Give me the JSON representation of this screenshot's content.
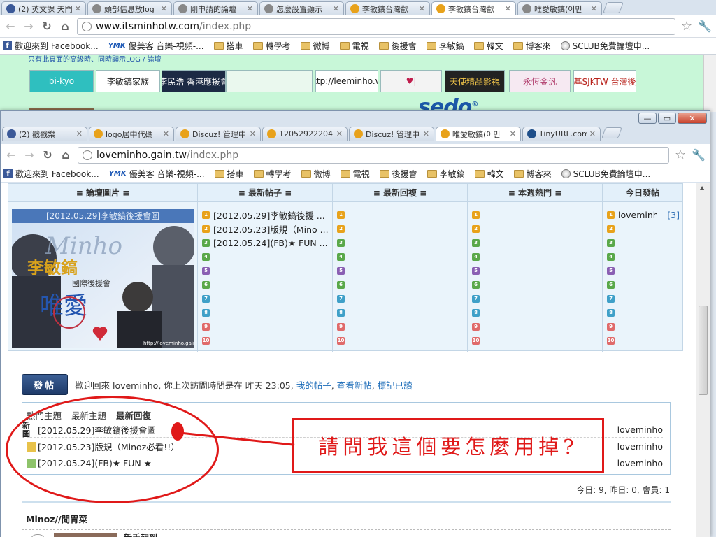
{
  "window1": {
    "tabs": [
      {
        "title": "(2) 英文課 天門",
        "color": "#3b5998"
      },
      {
        "title": "頭部信息放log",
        "color": "#888888"
      },
      {
        "title": "剛申請的論壇",
        "color": "#888888"
      },
      {
        "title": "怎麼設置顯示",
        "color": "#888888"
      },
      {
        "title": "李敏鎬台灣歡",
        "color": "#e8a21b"
      },
      {
        "title": "李敏鎬台灣歡",
        "color": "#e8a21b"
      },
      {
        "title": "唯愛敏鎬(이민",
        "color": "#888888"
      }
    ],
    "url_host": "www.itsminhotw.com",
    "url_path": "/index.php",
    "hidden_text": "只有此頁面的高級時、同時顯示LOG / 論壇",
    "banners": [
      {
        "text": "bi-kyo",
        "bg": "#2fbfbf",
        "fg": "#ffffff"
      },
      {
        "text": "李敏鎬家族",
        "bg": "#ffffff",
        "fg": "#222222"
      },
      {
        "text": "李民浩 香港應援會",
        "bg": "#1c2a44",
        "fg": "#ffffff"
      },
      {
        "text": "",
        "bg": "#eaf8ee",
        "fg": "#222222"
      },
      {
        "text": "http://leeminho.vn",
        "bg": "#ffffff",
        "fg": "#222222"
      },
      {
        "text": "♥|",
        "bg": "#f3f3f3",
        "fg": "#c01c4c"
      },
      {
        "text": "天使精品影視",
        "bg": "#222222",
        "fg": "#f3c64a"
      },
      {
        "text": "永恆金汎",
        "bg": "#f6e9f2",
        "fg": "#b03a6a"
      },
      {
        "text": "宋仲基SJKTW 台灣後援會",
        "bg": "#ffffff",
        "fg": "#b8221b"
      }
    ],
    "sedo": "sedo"
  },
  "window2": {
    "tabs": [
      {
        "title": "(2) 戳戳樂",
        "color": "#3b5998"
      },
      {
        "title": "logo居中代碼",
        "color": "#e8a21b"
      },
      {
        "title": "Discuz! 管理中",
        "color": "#e8a21b"
      },
      {
        "title": "12052922204",
        "color": "#e8a21b"
      },
      {
        "title": "Discuz! 管理中",
        "color": "#e8a21b"
      },
      {
        "title": "唯愛敏鎬(이민",
        "color": "#e8a21b"
      },
      {
        "title": "TinyURL.com",
        "color": "#1f4f8a"
      }
    ],
    "url_host": "loveminho.gain.tw",
    "url_path": "/index.php"
  },
  "bookmarks": [
    {
      "label": "歡迎來到 Facebook...",
      "icon": "facebook-icon"
    },
    {
      "label": "優美客 音樂-視頻-...",
      "icon": "ymk-icon"
    },
    {
      "label": "搭車",
      "icon": "folder-icon"
    },
    {
      "label": "轉學考",
      "icon": "folder-icon"
    },
    {
      "label": "微博",
      "icon": "folder-icon"
    },
    {
      "label": "電視",
      "icon": "folder-icon"
    },
    {
      "label": "後援會",
      "icon": "folder-icon"
    },
    {
      "label": "李敏鎬",
      "icon": "folder-icon"
    },
    {
      "label": "韓文",
      "icon": "folder-icon"
    },
    {
      "label": "博客來",
      "icon": "folder-icon"
    },
    {
      "label": "SCLUB免費論壇申...",
      "icon": "globe-icon"
    }
  ],
  "forum": {
    "columns": [
      "≡ 論壇圖片 ≡",
      "≡ 最新帖子 ≡",
      "≡ 最新回複 ≡",
      "≡ 本週熱門 ≡",
      "今日發帖"
    ],
    "thumb_caption": "[2012.05.29]李敏鎬後援會圖",
    "thumb_url": "http://loveminho.gain.tw",
    "thumb_words": {
      "minho": "Minho",
      "name": "李敏鎬",
      "sub": "國際後援會",
      "love": "唯愛"
    },
    "latest_posts": [
      "[2012.05.29]李敏鎬後援 ...",
      "[2012.05.23]版規（Mino ...",
      "[2012.05.24](FB)★ FUN ..."
    ],
    "today_user": "loveminh",
    "today_count": "[3]",
    "rank_numbers": [
      "1",
      "2",
      "3",
      "4",
      "5",
      "6",
      "7",
      "8",
      "9",
      "10"
    ],
    "rank_colors": [
      "#e8a21b",
      "#e8a21b",
      "#5aa84a",
      "#5aa84a",
      "#8a5fb3",
      "#5aa84a",
      "#3fa0c8",
      "#3fa0c8",
      "#e06a6a",
      "#e06a6a"
    ]
  },
  "postbar": {
    "button": "發帖",
    "welcome_prefix": "歡迎回來 loveminho, 你上次訪問時間是在 昨天 23:05,",
    "links": [
      "我的帖子",
      "查看新帖",
      "標記已讀"
    ]
  },
  "news": {
    "tabs": [
      "熱門主題",
      "最新主題",
      "最新回復"
    ],
    "new_badge": "新圖",
    "rows": [
      {
        "title": "[2012.05.29]李敏鎬後援會圖",
        "author": "loveminho"
      },
      {
        "title": "[2012.05.23]版規（Minoz必看!!）",
        "author": "loveminho"
      },
      {
        "title": "[2012.05.24](FB)★ FUN ★",
        "author": "loveminho"
      }
    ]
  },
  "stats": "今日: 9, 昨日: 0, 會員: 1",
  "section_title": "Minoz//閒胃菜",
  "next_item": "新手報到",
  "annotation": {
    "text": "請問我這個要怎麼用掉?",
    "color": "#e01919"
  }
}
